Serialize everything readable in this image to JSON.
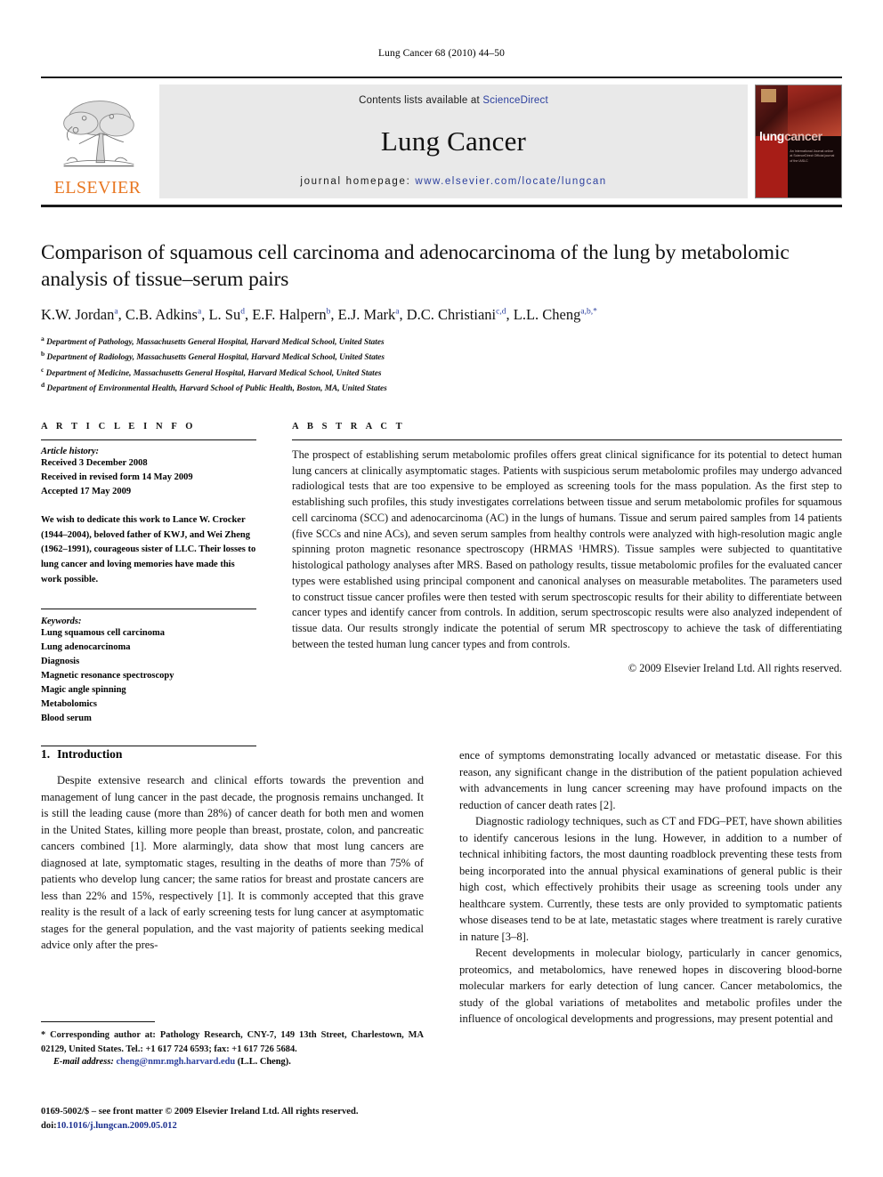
{
  "running_head": "Lung Cancer 68 (2010) 44–50",
  "masthead": {
    "publisher_name": "ELSEVIER",
    "contents_prefix": "Contents lists available at",
    "contents_link": "ScienceDirect",
    "journal_name": "Lung Cancer",
    "homepage_label": "journal homepage:",
    "homepage_url": "www.elsevier.com/locate/lungcan",
    "cover": {
      "word1": "lung",
      "word2": "cancer",
      "subtitle": "An International Journal\nonline at ScienceDirect\nOfficial journal of the IASLC"
    },
    "link_color": "#2b3f9e",
    "elsevier_orange": "#E87722"
  },
  "title": "Comparison of squamous cell carcinoma and adenocarcinoma of the lung by metabolomic analysis of tissue–serum pairs",
  "authors_html": "K.W. Jordan a, C.B. Adkins a, L. Su d, E.F. Halpern b, E.J. Mark a, D.C. Christiani c,d, L.L. Cheng a,b,*",
  "authors": [
    {
      "name": "K.W. Jordan",
      "sup": "a"
    },
    {
      "name": "C.B. Adkins",
      "sup": "a"
    },
    {
      "name": "L. Su",
      "sup": "d"
    },
    {
      "name": "E.F. Halpern",
      "sup": "b"
    },
    {
      "name": "E.J. Mark",
      "sup": "a"
    },
    {
      "name": "D.C. Christiani",
      "sup": "c,d"
    },
    {
      "name": "L.L. Cheng",
      "sup": "a,b,*"
    }
  ],
  "affiliations": [
    {
      "sup": "a",
      "text": "Department of Pathology, Massachusetts General Hospital, Harvard Medical School, United States"
    },
    {
      "sup": "b",
      "text": "Department of Radiology, Massachusetts General Hospital, Harvard Medical School, United States"
    },
    {
      "sup": "c",
      "text": "Department of Medicine, Massachusetts General Hospital, Harvard Medical School, United States"
    },
    {
      "sup": "d",
      "text": "Department of Environmental Health, Harvard School of Public Health, Boston, MA, United States"
    }
  ],
  "article_info": {
    "label": "A R T I C L E    I N F O",
    "history_heading": "Article history:",
    "history": [
      "Received 3 December 2008",
      "Received in revised form 14 May 2009",
      "Accepted 17 May 2009"
    ],
    "dedication": "We wish to dedicate this work to Lance W. Crocker (1944–2004), beloved father of KWJ, and Wei Zheng (1962–1991), courageous sister of LLC. Their losses to lung cancer and loving memories have made this work possible.",
    "keywords_heading": "Keywords:",
    "keywords": [
      "Lung squamous cell carcinoma",
      "Lung adenocarcinoma",
      "Diagnosis",
      "Magnetic resonance spectroscopy",
      "Magic angle spinning",
      "Metabolomics",
      "Blood serum"
    ]
  },
  "abstract": {
    "label": "A B S T R A C T",
    "text": "The prospect of establishing serum metabolomic profiles offers great clinical significance for its potential to detect human lung cancers at clinically asymptomatic stages. Patients with suspicious serum metabolomic profiles may undergo advanced radiological tests that are too expensive to be employed as screening tools for the mass population. As the first step to establishing such profiles, this study investigates correlations between tissue and serum metabolomic profiles for squamous cell carcinoma (SCC) and adenocarcinoma (AC) in the lungs of humans. Tissue and serum paired samples from 14 patients (five SCCs and nine ACs), and seven serum samples from healthy controls were analyzed with high-resolution magic angle spinning proton magnetic resonance spectroscopy (HRMAS ¹HMRS). Tissue samples were subjected to quantitative histological pathology analyses after MRS. Based on pathology results, tissue metabolomic profiles for the evaluated cancer types were established using principal component and canonical analyses on measurable metabolites. The parameters used to construct tissue cancer profiles were then tested with serum spectroscopic results for their ability to differentiate between cancer types and identify cancer from controls. In addition, serum spectroscopic results were also analyzed independent of tissue data. Our results strongly indicate the potential of serum MR spectroscopy to achieve the task of differentiating between the tested human lung cancer types and from controls.",
    "copyright": "© 2009 Elsevier Ireland Ltd. All rights reserved."
  },
  "body": {
    "section_number": "1.",
    "section_title": "Introduction",
    "left_paragraphs": [
      "Despite extensive research and clinical efforts towards the prevention and management of lung cancer in the past decade, the prognosis remains unchanged. It is still the leading cause (more than 28%) of cancer death for both men and women in the United States, killing more people than breast, prostate, colon, and pancreatic cancers combined [1]. More alarmingly, data show that most lung cancers are diagnosed at late, symptomatic stages, resulting in the deaths of more than 75% of patients who develop lung cancer; the same ratios for breast and prostate cancers are less than 22% and 15%, respectively [1]. It is commonly accepted that this grave reality is the result of a lack of early screening tests for lung cancer at asymptomatic stages for the general population, and the vast majority of patients seeking medical advice only after the pres-"
    ],
    "right_paragraphs": [
      "ence of symptoms demonstrating locally advanced or metastatic disease. For this reason, any significant change in the distribution of the patient population achieved with advancements in lung cancer screening may have profound impacts on the reduction of cancer death rates [2].",
      "Diagnostic radiology techniques, such as CT and FDG–PET, have shown abilities to identify cancerous lesions in the lung. However, in addition to a number of technical inhibiting factors, the most daunting roadblock preventing these tests from being incorporated into the annual physical examinations of general public is their high cost, which effectively prohibits their usage as screening tools under any healthcare system. Currently, these tests are only provided to symptomatic patients whose diseases tend to be at late, metastatic stages where treatment is rarely curative in nature [3–8].",
      "Recent developments in molecular biology, particularly in cancer genomics, proteomics, and metabolomics, have renewed hopes in discovering blood-borne molecular markers for early detection of lung cancer. Cancer metabolomics, the study of the global variations of metabolites and metabolic profiles under the influence of oncological developments and progressions, may present potential and"
    ]
  },
  "footnotes": {
    "corresponding": "* Corresponding author at: Pathology Research, CNY-7, 149 13th Street, Charlestown, MA 02129, United States. Tel.: +1 617 724 6593; fax: +1 617 726 5684.",
    "email_label": "E-mail address:",
    "email_address": "cheng@nmr.mgh.harvard.edu",
    "email_owner": "(L.L. Cheng).",
    "issn_line": "0169-5002/$ – see front matter © 2009 Elsevier Ireland Ltd. All rights reserved.",
    "doi_prefix": "doi:",
    "doi": "10.1016/j.lungcan.2009.05.012"
  }
}
